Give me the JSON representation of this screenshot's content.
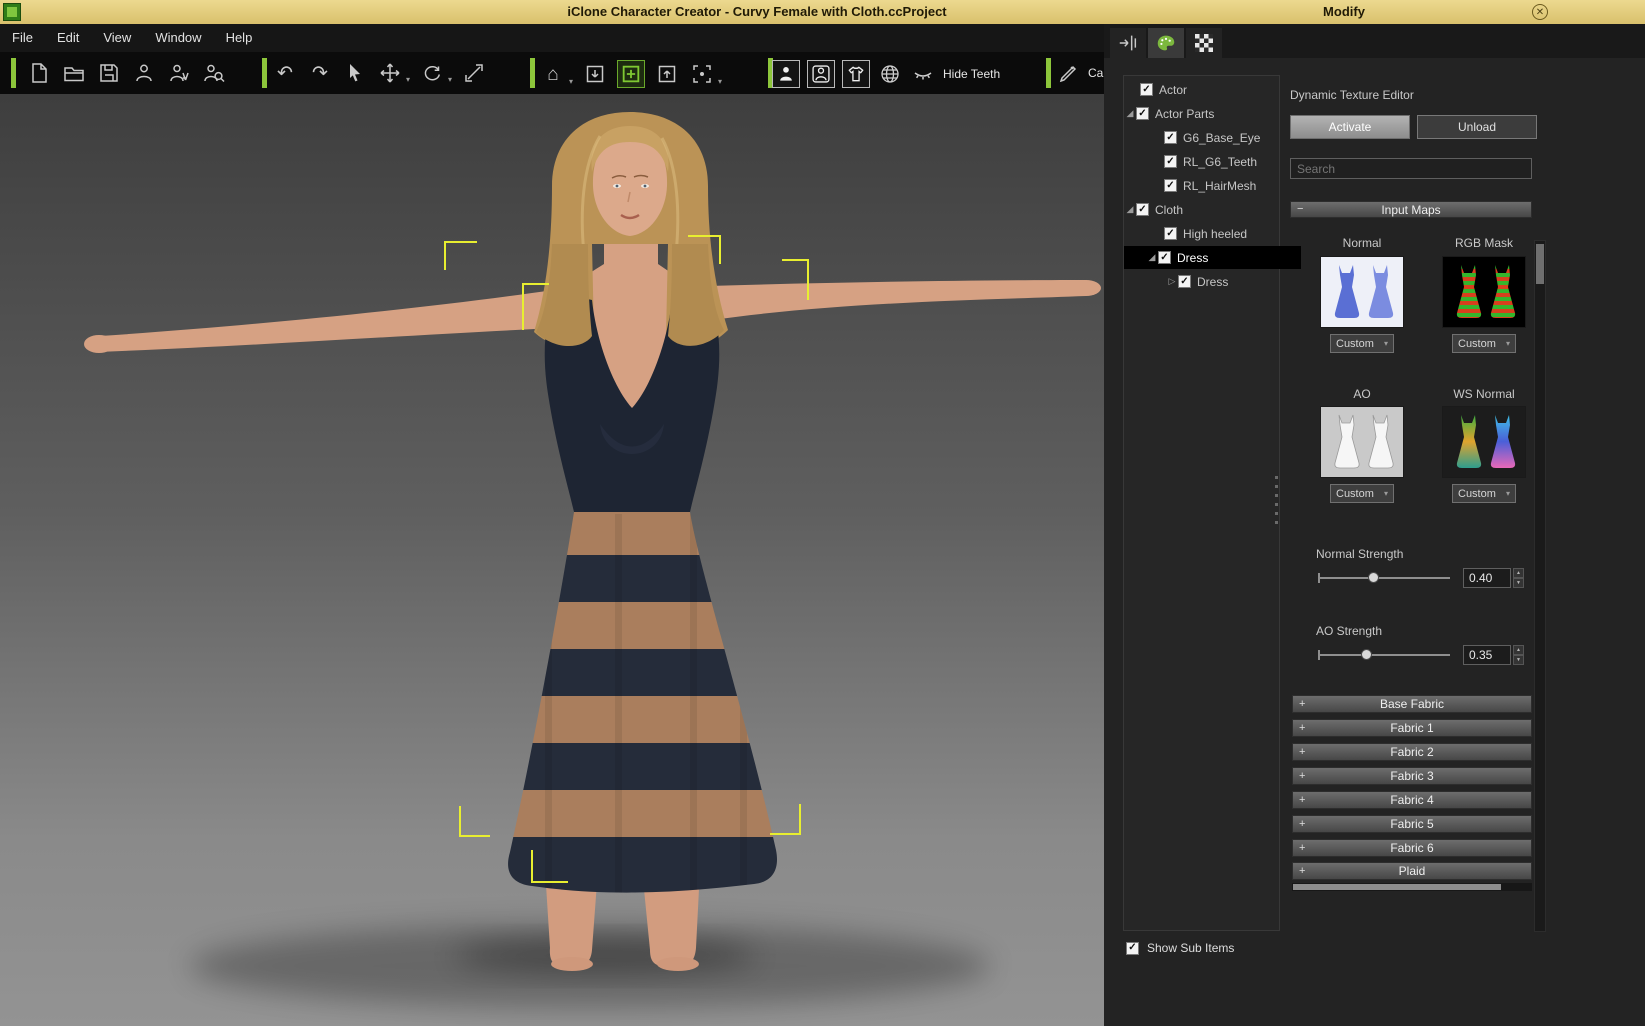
{
  "titlebar": {
    "title": "iClone Character Creator - Curvy Female with Cloth.ccProject"
  },
  "menu": {
    "items": [
      "File",
      "Edit",
      "View",
      "Window",
      "Help"
    ]
  },
  "toolbar": {
    "hide_teeth": "Hide Teeth",
    "cali": "Cali"
  },
  "modify": {
    "header": "Modify",
    "tree": [
      {
        "label": "Actor"
      },
      {
        "label": "Actor Parts"
      },
      {
        "label": "G6_Base_Eye"
      },
      {
        "label": "RL_G6_Teeth"
      },
      {
        "label": "RL_HairMesh"
      },
      {
        "label": "Cloth"
      },
      {
        "label": "High heeled"
      },
      {
        "label": "Dress"
      },
      {
        "label": "Dress"
      }
    ],
    "dte_title": "Dynamic Texture Editor",
    "activate": "Activate",
    "unload": "Unload",
    "search_placeholder": "Search",
    "input_maps": "Input Maps",
    "maps": [
      {
        "label": "Normal",
        "value": "Custom"
      },
      {
        "label": "RGB Mask",
        "value": "Custom"
      },
      {
        "label": "AO",
        "value": "Custom"
      },
      {
        "label": "WS Normal",
        "value": "Custom"
      }
    ],
    "normal_strength": {
      "label": "Normal Strength",
      "value": "0.40"
    },
    "ao_strength": {
      "label": "AO Strength",
      "value": "0.35"
    },
    "fabrics": [
      "Base Fabric",
      "Fabric 1",
      "Fabric 2",
      "Fabric 3",
      "Fabric 4",
      "Fabric 5",
      "Fabric 6",
      "Plaid"
    ],
    "show_sub_items": "Show Sub Items"
  },
  "glyphs": {
    "check": "✓",
    "expanded": "◢",
    "collapsed": "▷",
    "caret": "▾",
    "minus": "−",
    "plus": "+",
    "close": "✕",
    "up": "▲",
    "down": "▼",
    "undo": "↶",
    "redo": "↷",
    "home": "⌂"
  },
  "colors": {
    "accent_green": "#8dc63b",
    "titlebar_tan": "#e2cf82",
    "selection_yellow": "#e8ee30"
  }
}
